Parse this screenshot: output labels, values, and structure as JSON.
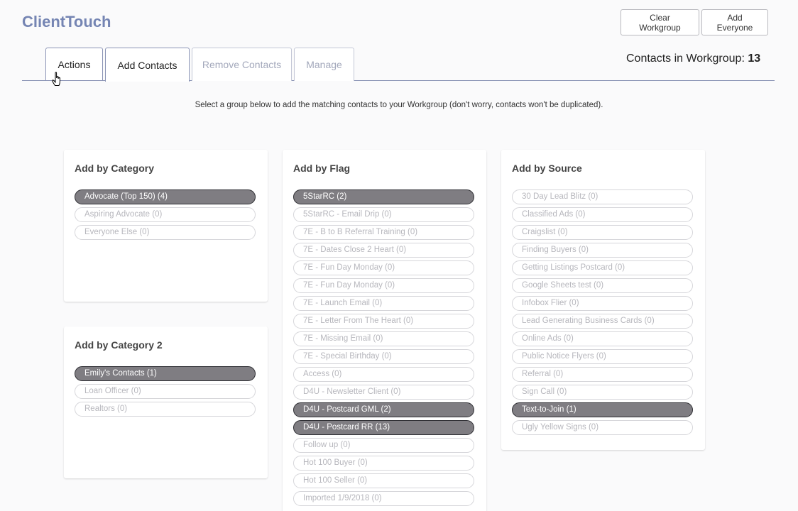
{
  "app": {
    "title": "ClientTouch"
  },
  "header": {
    "clear_label": "Clear Workgroup",
    "everyone_label": "Add Everyone"
  },
  "tabs": [
    "Actions",
    "Add Contacts",
    "Remove Contacts",
    "Manage"
  ],
  "workgroup": {
    "label": "Contacts in Workgroup: ",
    "count": "13"
  },
  "instructions": "Select a group below to add the matching contacts to your Workgroup (don't worry, contacts won't be duplicated).",
  "panels": {
    "category": {
      "title": "Add by Category",
      "items": [
        {
          "label": "Advocate (Top 150) (4)",
          "active": true
        },
        {
          "label": "Aspiring Advocate (0)",
          "active": false
        },
        {
          "label": "Everyone Else (0)",
          "active": false
        }
      ]
    },
    "category2": {
      "title": "Add by Category 2",
      "items": [
        {
          "label": "Emily's Contacts (1)",
          "active": true
        },
        {
          "label": "Loan Officer (0)",
          "active": false
        },
        {
          "label": "Realtors (0)",
          "active": false
        }
      ]
    },
    "flag": {
      "title": "Add by Flag",
      "items": [
        {
          "label": "5StarRC (2)",
          "active": true
        },
        {
          "label": "5StarRC - Email Drip (0)",
          "active": false
        },
        {
          "label": "7E - B to B Referral Training (0)",
          "active": false
        },
        {
          "label": "7E - Dates Close 2 Heart (0)",
          "active": false
        },
        {
          "label": "7E - Fun Day Monday (0)",
          "active": false
        },
        {
          "label": "7E - Fun Day Monday (0)",
          "active": false
        },
        {
          "label": "7E - Launch Email (0)",
          "active": false
        },
        {
          "label": "7E - Letter From The Heart (0)",
          "active": false
        },
        {
          "label": "7E - Missing Email (0)",
          "active": false
        },
        {
          "label": "7E - Special Birthday (0)",
          "active": false
        },
        {
          "label": "Access (0)",
          "active": false
        },
        {
          "label": "D4U - Newsletter Client (0)",
          "active": false
        },
        {
          "label": "D4U - Postcard GML (2)",
          "active": true
        },
        {
          "label": "D4U - Postcard RR (13)",
          "active": true
        },
        {
          "label": "Follow up (0)",
          "active": false
        },
        {
          "label": "Hot 100 Buyer (0)",
          "active": false
        },
        {
          "label": "Hot 100 Seller (0)",
          "active": false
        },
        {
          "label": "Imported 1/9/2018 (0)",
          "active": false
        }
      ]
    },
    "source": {
      "title": "Add by Source",
      "items": [
        {
          "label": "30 Day Lead Blitz (0)",
          "active": false
        },
        {
          "label": "Classified Ads (0)",
          "active": false
        },
        {
          "label": "Craigslist (0)",
          "active": false
        },
        {
          "label": "Finding Buyers (0)",
          "active": false
        },
        {
          "label": "Getting Listings Postcard (0)",
          "active": false
        },
        {
          "label": "Google Sheets test (0)",
          "active": false
        },
        {
          "label": "Infobox Flier (0)",
          "active": false
        },
        {
          "label": "Lead Generating Business Cards (0)",
          "active": false
        },
        {
          "label": "Online Ads (0)",
          "active": false
        },
        {
          "label": "Public Notice Flyers (0)",
          "active": false
        },
        {
          "label": "Referral (0)",
          "active": false
        },
        {
          "label": "Sign Call (0)",
          "active": false
        },
        {
          "label": "Text-to-Join (1)",
          "active": true
        },
        {
          "label": "Ugly Yellow Signs (0)",
          "active": false
        }
      ]
    }
  },
  "colors": {
    "brand": "#7585b3",
    "active_pill": "#7f7d82",
    "inactive_text": "#b7b7bd"
  },
  "icons": {
    "cursor": "hand-pointer-icon"
  }
}
